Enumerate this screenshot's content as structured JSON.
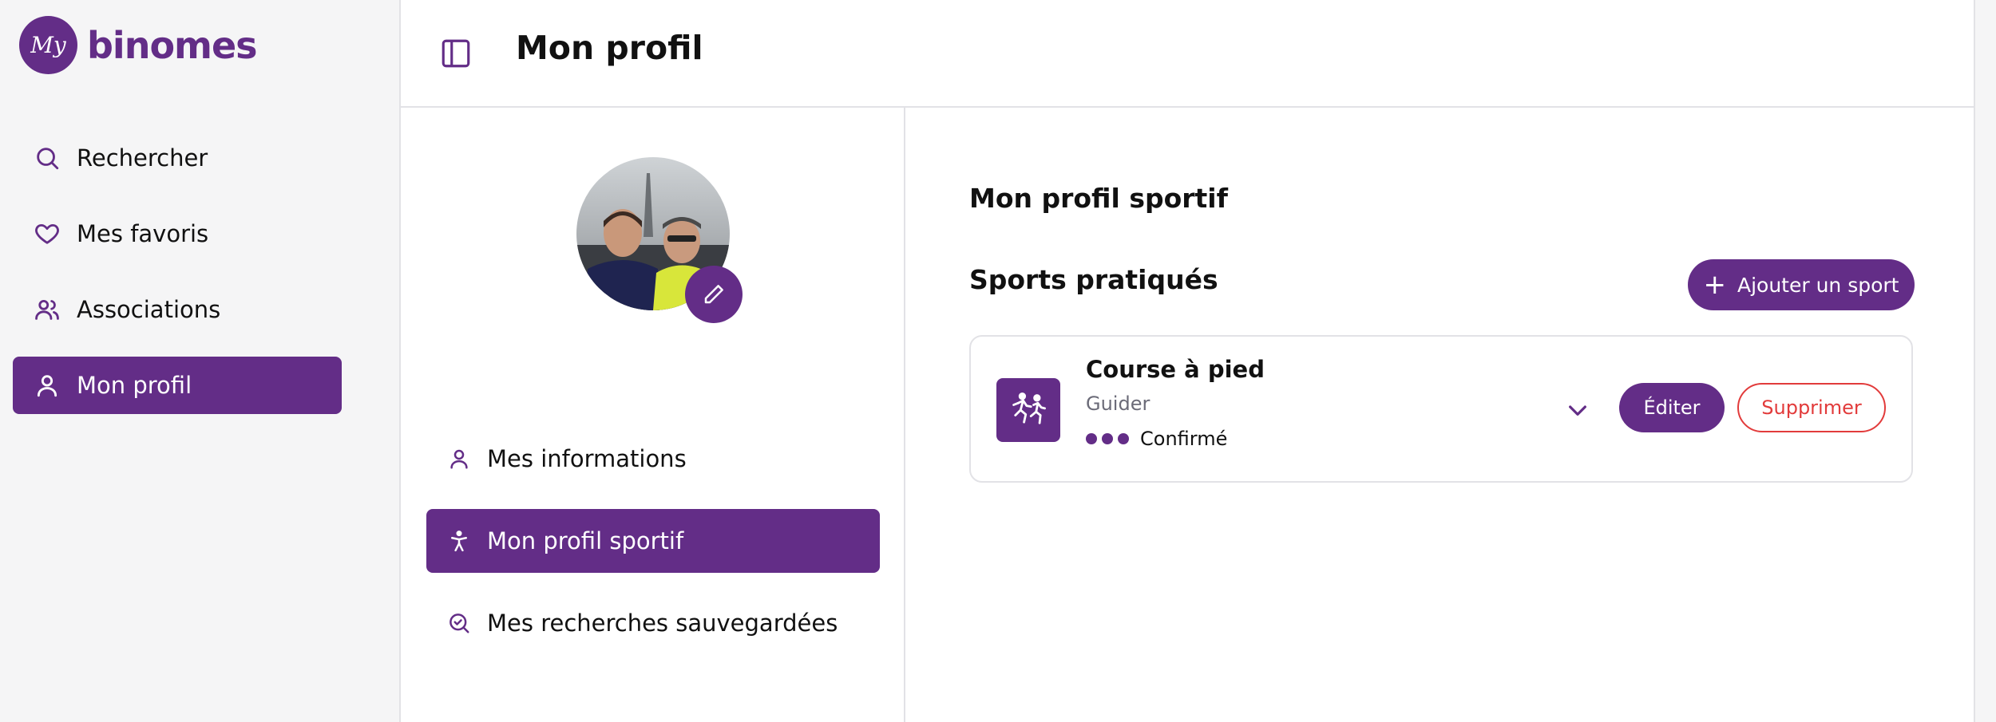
{
  "brand": {
    "badge_text": "My",
    "name": "binomes",
    "color": "#632d87"
  },
  "sidebar": {
    "items": [
      {
        "label": "Rechercher",
        "icon": "search-icon",
        "active": false
      },
      {
        "label": "Mes favoris",
        "icon": "heart-icon",
        "active": false
      },
      {
        "label": "Associations",
        "icon": "users-icon",
        "active": false
      },
      {
        "label": "Mon profil",
        "icon": "user-icon",
        "active": true
      }
    ]
  },
  "header": {
    "title": "Mon profil",
    "toggle_icon": "sidebar-toggle-icon"
  },
  "profile_nav": {
    "items": [
      {
        "label": "Mes informations",
        "icon": "user-icon",
        "active": false
      },
      {
        "label": "Mon profil sportif",
        "icon": "accessibility-icon",
        "active": true
      },
      {
        "label": "Mes recherches sauvegardées",
        "icon": "search-check-icon",
        "active": false
      }
    ]
  },
  "sport_profile": {
    "title": "Mon profil sportif",
    "sports_title": "Sports pratiqués",
    "add_button": "Ajouter un sport",
    "sports": [
      {
        "name": "Course à pied",
        "role": "Guider",
        "level_label": "Confirmé",
        "level_dots": 3,
        "icon": "running-icon",
        "edit_label": "Éditer",
        "delete_label": "Supprimer"
      }
    ]
  },
  "colors": {
    "accent": "#632d87",
    "danger": "#e23b3b",
    "muted": "#6b6b78"
  }
}
